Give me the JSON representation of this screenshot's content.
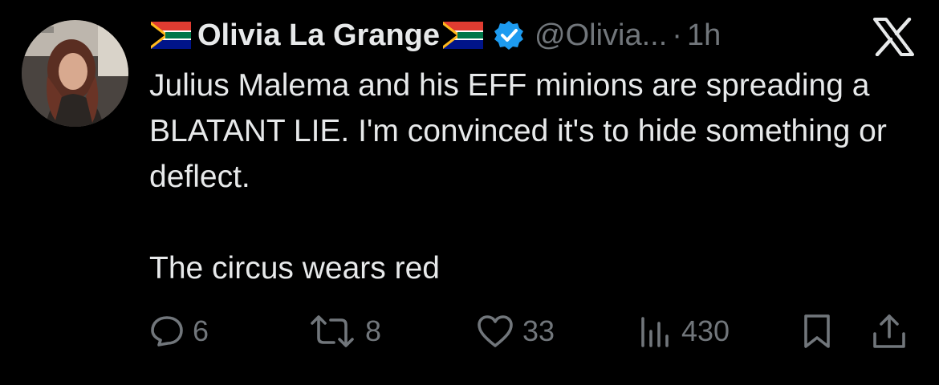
{
  "tweet": {
    "display_name": "Olivia La Grange",
    "handle": "@Olivia...",
    "separator": "·",
    "time": "1h",
    "body": {
      "line1": "Julius Malema and his EFF minions are spreading a BLATANT LIE. I'm convinced it's to hide something or deflect.",
      "line2": "The circus wears red"
    },
    "icons": {
      "flag": "south-africa-flag-emoji",
      "verified": "verified-badge-icon",
      "logo": "x-logo-icon"
    }
  },
  "actions": {
    "reply_count": "6",
    "retweet_count": "8",
    "like_count": "33",
    "views_count": "430"
  },
  "colors": {
    "background": "#000000",
    "text": "#e7e9ea",
    "muted": "#71767b",
    "verified": "#1d9bf0"
  }
}
